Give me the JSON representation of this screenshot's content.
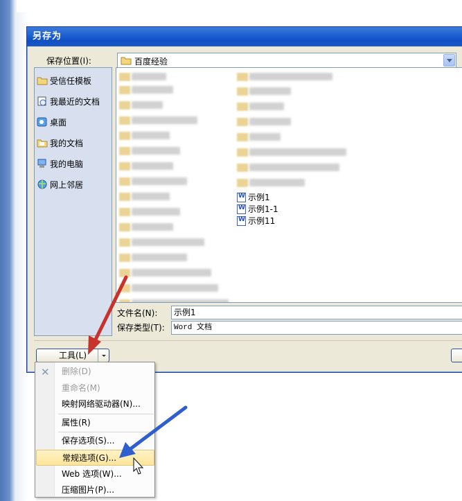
{
  "dialog": {
    "title": "另存为"
  },
  "location": {
    "label": "保存位置(I):",
    "value": "百度经验"
  },
  "places": [
    {
      "label": "受信任模板",
      "icon": "folder-icon"
    },
    {
      "label": "我最近的文档",
      "icon": "recent-documents-icon"
    },
    {
      "label": "桌面",
      "icon": "desktop-icon"
    },
    {
      "label": "我的文档",
      "icon": "my-documents-icon"
    },
    {
      "label": "我的电脑",
      "icon": "my-computer-icon"
    },
    {
      "label": "网上邻居",
      "icon": "network-places-icon"
    }
  ],
  "files": [
    {
      "name": "示例1",
      "icon": "word-document-icon"
    },
    {
      "name": "示例1-1",
      "icon": "word-document-icon"
    },
    {
      "name": "示例11",
      "icon": "word-document-icon"
    }
  ],
  "filename": {
    "label": "文件名(N):",
    "value": "示例1"
  },
  "filetype": {
    "label": "保存类型(T):",
    "value": "Word 文档"
  },
  "tools_button": {
    "label": "工具(L)"
  },
  "tools_menu": [
    {
      "label": "删除(D)",
      "enabled": false
    },
    {
      "label": "重命名(M)",
      "enabled": false
    },
    {
      "label": "映射网络驱动器(N)...",
      "enabled": true
    },
    {
      "label": "属性(R)",
      "enabled": true
    },
    {
      "label": "保存选项(S)...",
      "enabled": true
    },
    {
      "label": "常规选项(G)...",
      "enabled": true,
      "highlighted": true
    },
    {
      "label": "Web 选项(W)...",
      "enabled": true
    },
    {
      "label": "压缩图片(P)...",
      "enabled": true
    }
  ],
  "colors": {
    "title_bar": "#1d5fd0",
    "annotation_red": "#c8322c",
    "annotation_blue": "#2f5fcf",
    "menu_highlight": "#fde59a"
  }
}
